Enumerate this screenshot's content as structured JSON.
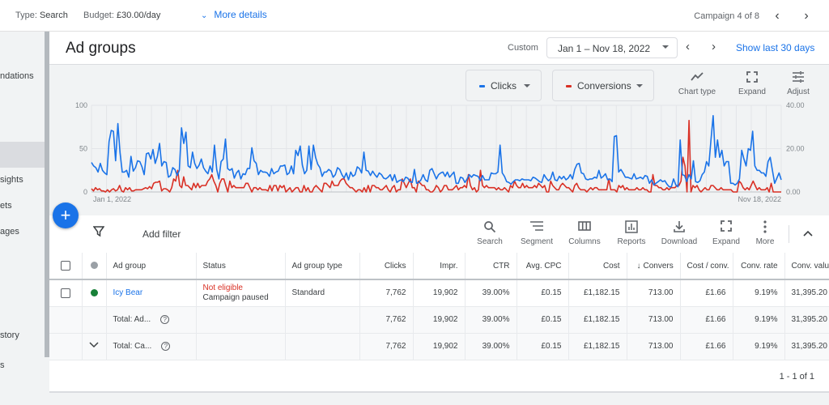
{
  "topbar": {
    "type_label": "Type:",
    "type_value": "Search",
    "budget_label": "Budget:",
    "budget_value": "£30.00/day",
    "more_details": "More details",
    "campaign_position": "Campaign 4 of 8"
  },
  "sidebar": {
    "items": [
      {
        "label": "ndations"
      },
      {
        "label": ""
      },
      {
        "label": "sights"
      },
      {
        "label": "ets"
      },
      {
        "label": "ages"
      },
      {
        "label": "story"
      },
      {
        "label": "s"
      }
    ]
  },
  "header": {
    "title": "Ad groups",
    "date_preset": "Custom",
    "date_range": "Jan 1 – Nov 18, 2022",
    "show_last": "Show last 30 days"
  },
  "chart_controls": {
    "metric1": {
      "label": "Clicks",
      "color": "#1a73e8"
    },
    "metric2": {
      "label": "Conversions",
      "color": "#d93025"
    },
    "chart_type": "Chart type",
    "expand": "Expand",
    "adjust": "Adjust"
  },
  "chart_data": {
    "type": "line",
    "x_start_label": "Jan 1, 2022",
    "x_end_label": "Nov 18, 2022",
    "left_axis": {
      "ticks": [
        "100",
        "50",
        "0"
      ],
      "range": [
        0,
        100
      ]
    },
    "right_axis": {
      "ticks": [
        "40.00",
        "20.00",
        "0.00"
      ],
      "range": [
        0,
        40
      ]
    },
    "grid": true,
    "series": [
      {
        "name": "Clicks",
        "axis": "left",
        "color": "#1a73e8",
        "values": [
          34,
          30,
          28,
          23,
          33,
          25,
          22,
          20,
          58,
          71,
          70,
          36,
          79,
          45,
          23,
          23,
          25,
          17,
          41,
          24,
          28,
          36,
          35,
          29,
          20,
          44,
          45,
          38,
          49,
          33,
          41,
          56,
          30,
          35,
          34,
          17,
          19,
          28,
          26,
          19,
          25,
          74,
          56,
          69,
          30,
          28,
          46,
          33,
          27,
          31,
          38,
          28,
          24,
          21,
          30,
          23,
          54,
          26,
          15,
          35,
          38,
          61,
          27,
          25,
          27,
          16,
          22,
          25,
          15,
          21,
          20,
          27,
          27,
          51,
          36,
          33,
          20,
          25,
          23,
          23,
          22,
          18,
          27,
          21,
          23,
          24,
          30,
          30,
          31,
          20,
          22,
          30,
          21,
          48,
          42,
          53,
          31,
          21,
          25,
          53,
          26,
          54,
          40,
          32,
          28,
          18,
          23,
          23,
          26,
          24,
          17,
          20,
          28,
          26,
          20,
          16,
          22,
          14,
          23,
          18,
          20,
          29,
          27,
          22,
          46,
          25,
          24,
          19,
          24,
          20,
          17,
          22,
          20,
          16,
          15,
          17,
          20,
          13,
          20,
          11,
          13,
          14,
          12,
          17,
          16,
          12,
          11,
          26,
          10,
          11,
          14,
          20,
          14,
          12,
          25,
          27,
          21,
          15,
          20,
          22,
          23,
          18,
          23,
          17,
          20,
          23,
          10,
          10,
          17,
          16,
          11,
          15,
          20,
          17,
          20,
          19,
          18,
          13,
          19,
          14,
          14,
          14,
          22,
          21,
          21,
          23,
          54,
          22,
          18,
          12,
          11,
          9,
          12,
          14,
          14,
          13,
          15,
          14,
          14,
          14,
          13,
          17,
          16,
          14,
          12,
          11,
          20,
          16,
          13,
          15,
          23,
          14,
          13,
          18,
          15,
          18,
          14,
          16,
          20,
          15,
          26,
          32,
          33,
          22,
          21,
          15,
          14,
          15,
          15,
          17,
          16,
          25,
          16,
          18,
          21,
          14,
          15,
          12,
          64,
          65,
          23,
          26,
          22,
          17,
          17,
          16,
          15,
          21,
          15,
          16,
          17,
          15,
          19,
          18,
          10,
          14,
          8,
          10,
          12,
          14,
          12,
          13,
          9,
          6,
          6,
          15,
          8,
          6,
          60,
          20,
          19,
          12,
          20,
          15,
          36,
          12,
          11,
          13,
          20,
          23,
          35,
          30,
          60,
          88,
          40,
          60,
          40,
          48,
          30,
          35,
          35,
          10,
          10,
          8,
          10,
          15,
          48,
          38,
          30,
          50,
          48,
          70,
          30,
          25,
          25,
          22,
          22,
          18,
          35,
          40,
          25,
          10,
          16,
          22,
          14
        ]
      },
      {
        "name": "Conversions",
        "axis": "right",
        "color": "#d93025",
        "values": [
          1.5,
          0.5,
          2,
          1,
          1.5,
          0.5,
          0.5,
          0,
          1,
          0,
          1,
          1.5,
          0.5,
          1,
          3,
          0.5,
          0,
          2,
          1,
          2,
          0.5,
          0.5,
          1,
          1,
          1,
          1,
          1.5,
          2,
          1.5,
          2.5,
          1.5,
          4,
          4.5,
          4.5,
          5,
          0.5,
          1.5,
          1.5,
          1,
          0,
          2,
          6,
          5,
          10,
          3,
          2,
          7,
          3,
          3,
          2,
          1,
          4,
          2,
          4,
          2,
          3,
          3,
          3,
          5,
          6,
          8,
          5,
          3,
          0,
          4,
          6,
          6,
          3,
          0,
          5,
          2,
          3,
          2,
          2,
          2,
          2,
          2,
          4,
          4,
          2,
          0,
          2,
          2,
          1,
          2,
          1,
          1,
          1,
          0.5,
          3,
          0.5,
          3,
          3,
          0.5,
          3,
          2,
          3,
          0,
          1,
          2,
          0,
          1,
          2,
          2,
          0,
          0,
          3,
          0.5,
          2,
          0,
          0,
          2,
          3,
          2,
          1,
          0,
          4,
          4,
          3,
          2,
          5,
          3,
          3,
          3,
          5,
          6,
          6,
          4,
          3,
          2,
          2,
          1,
          0,
          1,
          1,
          0,
          2,
          0,
          3,
          0,
          3,
          3,
          2,
          2,
          1,
          1,
          2,
          3,
          1,
          0,
          2,
          3,
          0,
          1,
          1,
          6,
          4,
          2,
          4,
          6,
          2,
          2,
          0,
          5,
          4,
          3,
          3,
          1,
          1,
          0,
          0,
          1,
          3,
          2,
          0,
          1,
          3,
          3,
          1,
          1,
          1,
          2,
          3,
          1,
          2,
          2,
          3,
          2,
          8,
          3,
          1,
          2,
          0,
          1,
          10,
          3,
          2,
          3,
          2,
          2,
          2,
          2,
          1,
          2,
          1,
          1,
          2,
          1,
          0,
          3,
          2,
          5,
          3,
          2,
          2,
          4,
          2,
          3,
          2,
          2,
          2,
          3,
          2,
          4,
          3,
          2,
          3,
          0,
          0,
          5,
          3,
          2,
          1,
          1,
          3,
          4,
          3,
          2,
          2,
          1,
          0,
          3,
          4,
          2,
          1,
          1,
          1,
          0,
          1,
          2,
          1,
          2,
          2,
          1,
          1,
          1,
          1,
          1,
          6,
          1,
          1,
          1,
          0,
          3,
          2,
          3,
          1,
          2,
          1,
          1,
          1,
          1,
          2,
          1,
          1,
          2,
          1,
          1,
          0,
          0,
          8,
          3,
          3,
          2,
          2,
          1,
          1,
          2,
          1,
          2,
          2,
          2,
          3,
          3,
          5,
          16,
          12,
          0,
          33,
          0,
          3,
          2,
          3,
          1,
          0,
          1,
          2,
          1,
          1,
          3,
          3,
          2,
          1,
          1,
          2,
          1,
          1,
          1,
          1,
          1,
          0,
          0,
          0,
          5,
          4,
          2,
          1,
          2,
          1,
          3,
          5,
          3,
          1,
          2,
          1,
          1,
          1,
          2,
          0,
          4,
          0,
          0,
          0,
          0,
          0
        ]
      }
    ]
  },
  "toolbar": {
    "add_filter": "Add filter",
    "buttons": [
      {
        "label": "Search"
      },
      {
        "label": "Segment"
      },
      {
        "label": "Columns"
      },
      {
        "label": "Reports"
      },
      {
        "label": "Download"
      },
      {
        "label": "Expand"
      },
      {
        "label": "More"
      }
    ]
  },
  "table": {
    "columns": [
      "Ad group",
      "Status",
      "Ad group type",
      "Clicks",
      "Impr.",
      "CTR",
      "Avg. CPC",
      "Cost",
      "Conversions",
      "Cost / conv.",
      "Conv. rate",
      "Conv. value"
    ],
    "sorted_column_display": "Convers",
    "rows": [
      {
        "ad_group": "Icy Bear",
        "status_main": "Not eligible",
        "status_sub": "Campaign paused",
        "type": "Standard",
        "clicks": "7,762",
        "impr": "19,902",
        "ctr": "39.00%",
        "avg_cpc": "£0.15",
        "cost": "£1,182.15",
        "conversions": "713.00",
        "cost_per_conv": "£1.66",
        "conv_rate": "9.19%",
        "conv_value": "31,395.20",
        "status_dot_color": "#188038"
      }
    ],
    "totals": [
      {
        "label": "Total: Ad...",
        "clicks": "7,762",
        "impr": "19,902",
        "ctr": "39.00%",
        "avg_cpc": "£0.15",
        "cost": "£1,182.15",
        "conversions": "713.00",
        "cost_per_conv": "£1.66",
        "conv_rate": "9.19%",
        "conv_value": "31,395.20"
      },
      {
        "label": "Total: Ca...",
        "clicks": "7,762",
        "impr": "19,902",
        "ctr": "39.00%",
        "avg_cpc": "£0.15",
        "cost": "£1,182.15",
        "conversions": "713.00",
        "cost_per_conv": "£1.66",
        "conv_rate": "9.19%",
        "conv_value": "31,395.20"
      }
    ]
  },
  "pagination": {
    "text": "1 - 1 of 1"
  }
}
